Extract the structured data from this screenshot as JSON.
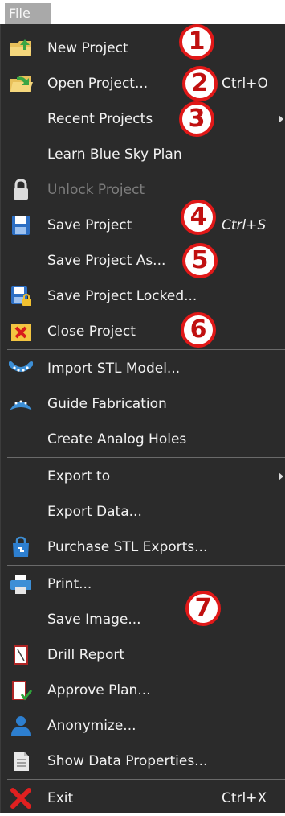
{
  "menubar": {
    "file_label_first": "F",
    "file_label_rest": "ile"
  },
  "menu": {
    "items": [
      {
        "label": "New Project",
        "shortcut": ""
      },
      {
        "label": "Open Project...",
        "shortcut": "Ctrl+O"
      },
      {
        "label": "Recent Projects",
        "shortcut": ""
      },
      {
        "label": "Learn Blue Sky Plan",
        "shortcut": ""
      },
      {
        "label": "Unlock Project",
        "shortcut": ""
      },
      {
        "label": "Save Project",
        "shortcut": "Ctrl+S"
      },
      {
        "label": "Save Project As...",
        "shortcut": ""
      },
      {
        "label": "Save Project Locked...",
        "shortcut": ""
      },
      {
        "label": "Close Project",
        "shortcut": ""
      },
      {
        "label": "Import STL Model...",
        "shortcut": ""
      },
      {
        "label": "Guide Fabrication",
        "shortcut": ""
      },
      {
        "label": "Create Analog Holes",
        "shortcut": ""
      },
      {
        "label": "Export to",
        "shortcut": ""
      },
      {
        "label": "Export Data...",
        "shortcut": ""
      },
      {
        "label": "Purchase STL Exports...",
        "shortcut": ""
      },
      {
        "label": "Print...",
        "shortcut": ""
      },
      {
        "label": "Save Image...",
        "shortcut": ""
      },
      {
        "label": "Drill Report",
        "shortcut": ""
      },
      {
        "label": "Approve Plan...",
        "shortcut": ""
      },
      {
        "label": "Anonymize...",
        "shortcut": ""
      },
      {
        "label": "Show Data Properties...",
        "shortcut": ""
      },
      {
        "label": "Exit",
        "shortcut": "Ctrl+X"
      }
    ],
    "icons": [
      "new-project-icon",
      "open-project-icon",
      "lock-icon",
      "save-icon",
      "save-locked-icon",
      "close-project-icon",
      "import-stl-icon",
      "guide-fabrication-icon",
      "purchase-bag-icon",
      "printer-icon",
      "drill-report-icon",
      "approve-plan-icon",
      "anonymize-user-icon",
      "document-icon",
      "exit-x-icon"
    ]
  },
  "annotations": [
    "1",
    "2",
    "3",
    "4",
    "5",
    "6",
    "7"
  ],
  "colors": {
    "menu_bg": "#2b2b2b",
    "text": "#f2f2f2",
    "disabled_text": "#7d7d7d",
    "badge_ring": "#e01818",
    "separator": "#6a6a6a"
  }
}
